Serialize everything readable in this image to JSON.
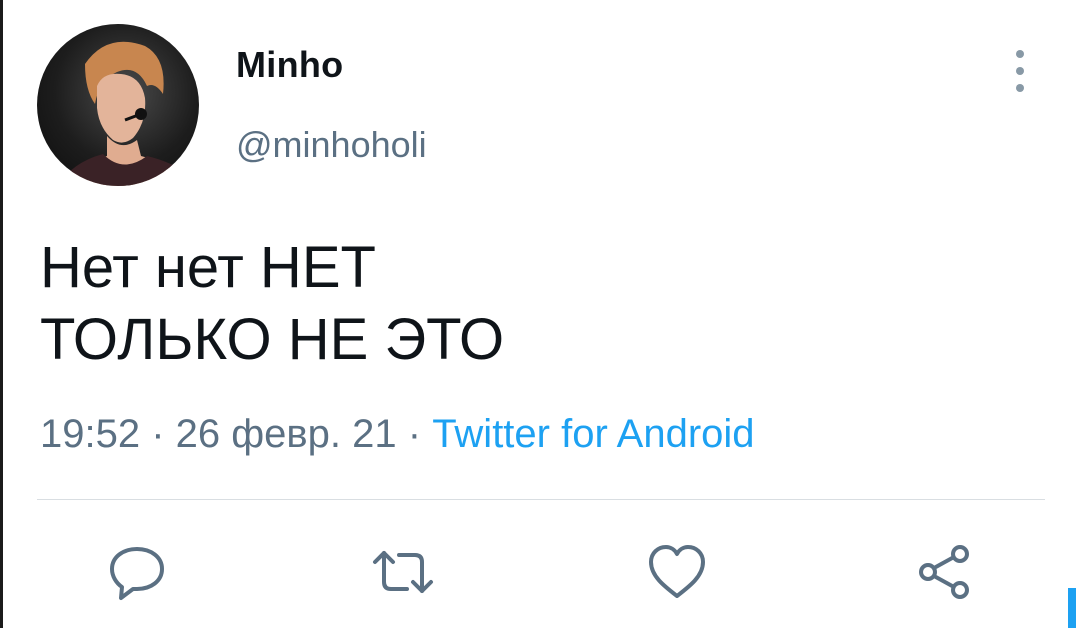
{
  "tweet": {
    "author": {
      "display_name": "Minho",
      "handle": "@minhoholi"
    },
    "text_lines": [
      "Нет нет НЕТ",
      "ТОЛЬКО НЕ ЭТО"
    ],
    "time": "19:52",
    "date": "26 февр. 21",
    "separator": " · ",
    "source": "Twitter for Android"
  },
  "actions": [
    {
      "name": "reply",
      "icon": "speech-bubble-icon"
    },
    {
      "name": "retweet",
      "icon": "retweet-icon"
    },
    {
      "name": "like",
      "icon": "heart-icon"
    },
    {
      "name": "share",
      "icon": "share-icon"
    }
  ],
  "colors": {
    "text_primary": "#0f1419",
    "text_secondary": "#5b7083",
    "link": "#1da1f2",
    "icon": "#5b7083"
  }
}
